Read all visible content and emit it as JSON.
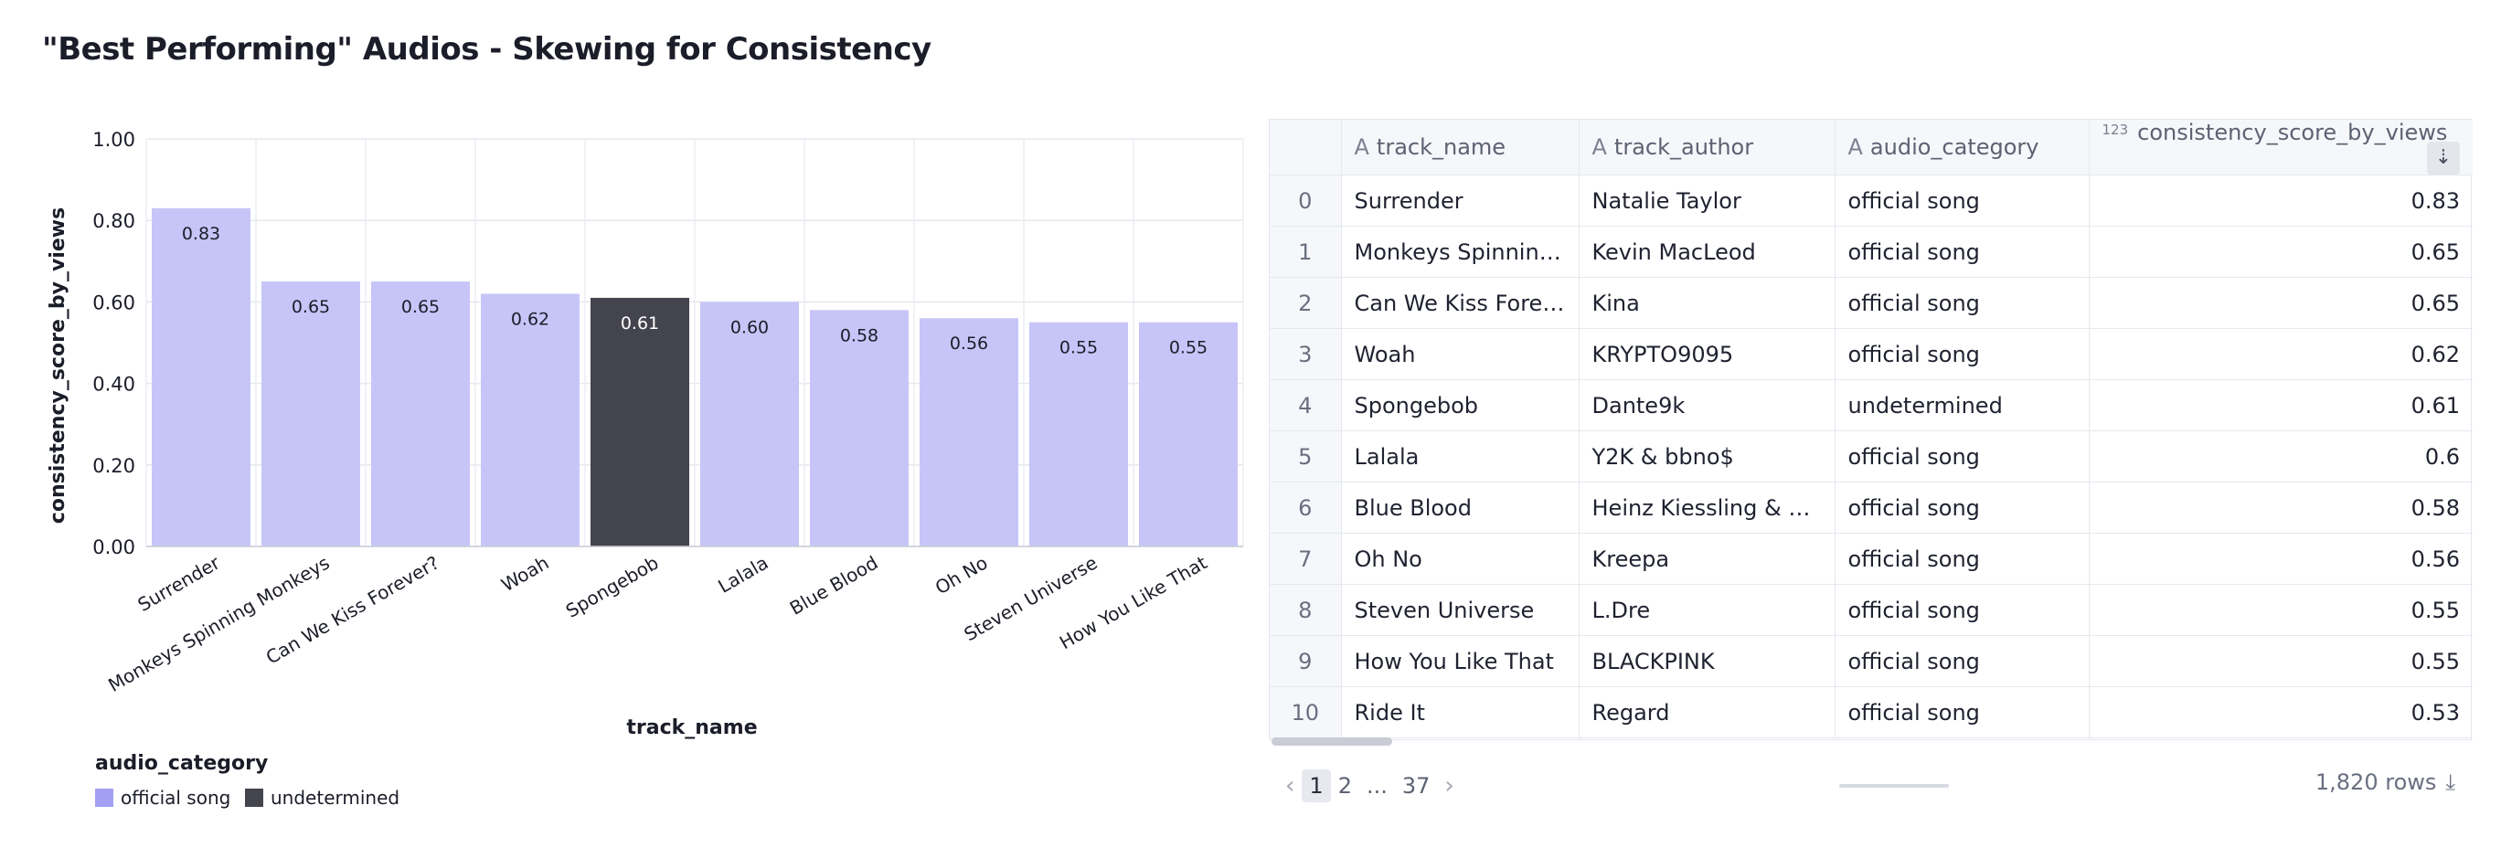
{
  "title": "\"Best Performing\" Audios - Skewing for Consistency",
  "colors": {
    "official_song": "#c7c5f8",
    "undetermined": "#44444f",
    "legend_official": "#a3a0f3"
  },
  "chart_data": {
    "type": "bar",
    "title": "",
    "xlabel": "track_name",
    "ylabel": "consistency_score_by_views",
    "ylim": [
      0,
      1
    ],
    "yticks": [
      "0.00",
      "0.20",
      "0.40",
      "0.60",
      "0.80",
      "1.00"
    ],
    "categories": [
      "Surrender",
      "Monkeys Spinning Monkeys",
      "Can We Kiss Forever?",
      "Woah",
      "Spongebob",
      "Lalala",
      "Blue Blood",
      "Oh No",
      "Steven Universe",
      "How You Like That"
    ],
    "values": [
      0.83,
      0.65,
      0.65,
      0.62,
      0.61,
      0.6,
      0.58,
      0.56,
      0.55,
      0.55
    ],
    "labels": [
      "0.83",
      "0.65",
      "0.65",
      "0.62",
      "0.61",
      "0.60",
      "0.58",
      "0.56",
      "0.55",
      "0.55"
    ],
    "color_by": [
      "official song",
      "official song",
      "official song",
      "official song",
      "undetermined",
      "official song",
      "official song",
      "official song",
      "official song",
      "official song"
    ],
    "grid": true,
    "legend": {
      "title": "audio_category",
      "placement": "bottom-left",
      "items": [
        "official song",
        "undetermined"
      ]
    }
  },
  "table": {
    "columns": [
      {
        "name": "track_name",
        "icon": "A"
      },
      {
        "name": "track_author",
        "icon": "A"
      },
      {
        "name": "audio_category",
        "icon": "A"
      },
      {
        "name": "consistency_score_by_views",
        "icon": "123"
      }
    ],
    "sort_icon": "sort-desc-icon",
    "rows": [
      [
        "0",
        "Surrender",
        "Natalie Taylor",
        "official song",
        "0.83"
      ],
      [
        "1",
        "Monkeys Spinning Monkeys",
        "Kevin MacLeod",
        "official song",
        "0.65"
      ],
      [
        "2",
        "Can We Kiss Forever?",
        "Kina",
        "official song",
        "0.65"
      ],
      [
        "3",
        "Woah",
        "KRYPTO9095",
        "official song",
        "0.62"
      ],
      [
        "4",
        "Spongebob",
        "Dante9k",
        "undetermined",
        "0.61"
      ],
      [
        "5",
        "Lalala",
        "Y2K & bbno$",
        "official song",
        "0.6"
      ],
      [
        "6",
        "Blue Blood",
        "Heinz Kiessling & Various Artists",
        "official song",
        "0.58"
      ],
      [
        "7",
        "Oh No",
        "Kreepa",
        "official song",
        "0.56"
      ],
      [
        "8",
        "Steven Universe",
        "L.Dre",
        "official song",
        "0.55"
      ],
      [
        "9",
        "How You Like That",
        "BLACKPINK",
        "official song",
        "0.55"
      ],
      [
        "10",
        "Ride It",
        "Regard",
        "official song",
        "0.53"
      ]
    ]
  },
  "pagination": {
    "prev": "‹",
    "pages": [
      "1",
      "2"
    ],
    "ellipsis": "...",
    "last": "37",
    "next": "›",
    "row_count": "1,820 rows",
    "download_icon": "download-icon"
  }
}
